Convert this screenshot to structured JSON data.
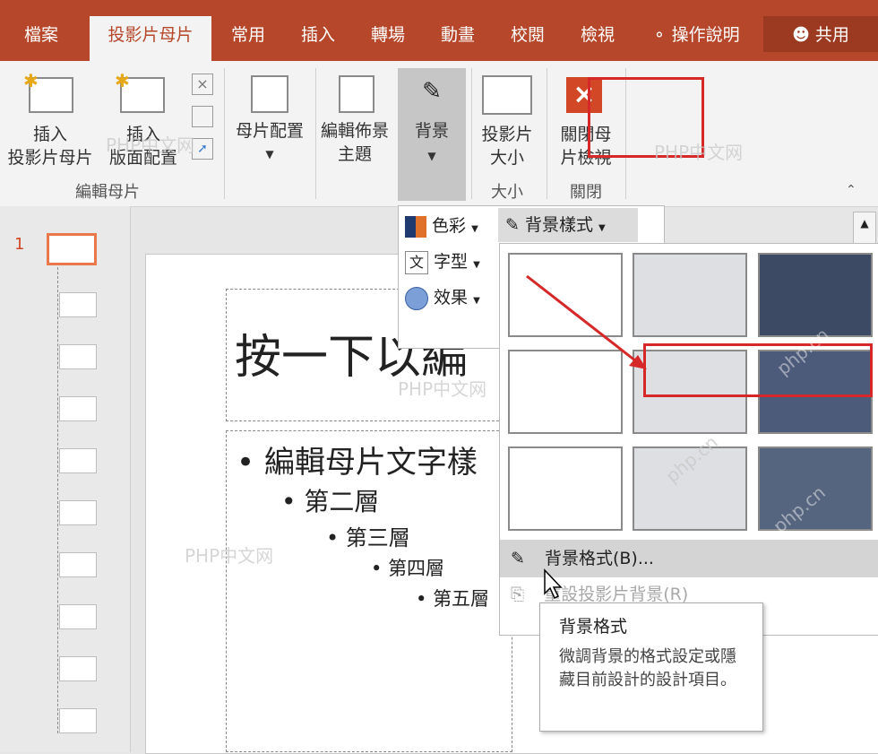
{
  "tabs": {
    "file": "檔案",
    "slide_master": "投影片母片",
    "home": "常用",
    "insert": "插入",
    "transitions": "轉場",
    "animations": "動畫",
    "review": "校閱",
    "view": "檢視",
    "tell_me": "操作說明",
    "share": "共用"
  },
  "ribbon": {
    "insert_slide_master": [
      "插入",
      "投影片母片"
    ],
    "insert_layout": [
      "插入",
      "版面配置"
    ],
    "master_layout": "母片配置",
    "edit_theme": [
      "編輯佈景",
      "主題"
    ],
    "background": "背景",
    "slide_size": [
      "投影片",
      "大小"
    ],
    "close_master_view": [
      "關閉母",
      "片檢視"
    ],
    "group_edit_master": "編輯母片",
    "group_size": "大小",
    "group_close": "關閉"
  },
  "thumbnails": {
    "first_number": "1"
  },
  "slide": {
    "title_placeholder": "按一下以編",
    "level1": "編輯母片文字樣",
    "level2": "第二層",
    "level3": "第三層",
    "level4": "第四層",
    "level5": "第五層"
  },
  "background_menu": {
    "colors": "色彩",
    "fonts": "字型",
    "effects": "效果",
    "background_styles": "背景樣式"
  },
  "gallery": {
    "format_background": "背景格式(B)...",
    "reset_background": "重設投影片背景(R)"
  },
  "tooltip": {
    "title": "背景格式",
    "body": "微調背景的格式設定或隱藏目前設計的設計項目。"
  },
  "watermark": {
    "text_cn": "PHP中文网",
    "text_en": "php.cn"
  },
  "colors": {
    "tab_bar": "#b7472a",
    "swatch_light_gray": "#dedfe2",
    "swatch_dark_1": "#3d4a63",
    "swatch_dark_2": "#4d5b7a",
    "swatch_dark_3": "#56657f",
    "highlight_red": "#d62828"
  }
}
